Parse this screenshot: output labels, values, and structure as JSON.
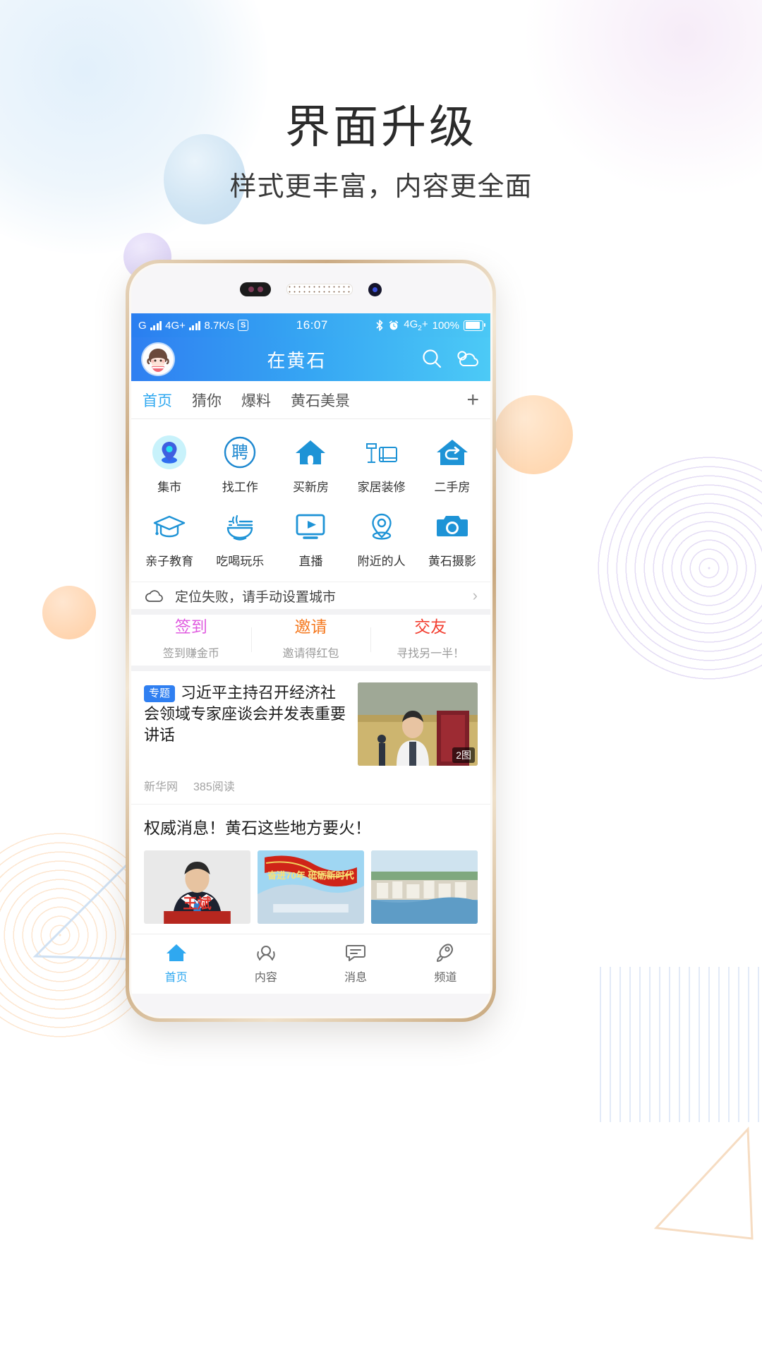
{
  "promo": {
    "title": "界面升级",
    "subtitle": "样式更丰富，内容更全面"
  },
  "phone": {
    "statusbar": {
      "carrier": "G",
      "network1": "4G+",
      "speed": "8.7K/s",
      "sync_badge": "S",
      "time": "16:07",
      "bluetooth_icon": "bluetooth-icon",
      "alarm_icon": "alarm-clock-icon",
      "network2": "4G",
      "network2_sub": "2",
      "network2_plus": "+",
      "battery": "100%"
    },
    "appbar": {
      "avatar": "user-avatar",
      "title": "在黄石",
      "search_icon": "search-icon",
      "weather_icon": "weather-cloud-icon"
    },
    "tabs": {
      "items": [
        {
          "label": "首页",
          "active": true
        },
        {
          "label": "猜你",
          "active": false
        },
        {
          "label": "爆料",
          "active": false
        },
        {
          "label": "黄石美景",
          "active": false
        }
      ],
      "add_label": "+"
    },
    "grid": [
      {
        "label": "集市",
        "icon": "location-pin-icon"
      },
      {
        "label": "找工作",
        "icon": "hire-circle-icon"
      },
      {
        "label": "买新房",
        "icon": "house-icon"
      },
      {
        "label": "家居装修",
        "icon": "furniture-icon"
      },
      {
        "label": "二手房",
        "icon": "secondhand-house-icon"
      },
      {
        "label": "亲子教育",
        "icon": "graduation-cap-icon"
      },
      {
        "label": "吃喝玩乐",
        "icon": "noodle-bowl-icon"
      },
      {
        "label": "直播",
        "icon": "live-play-icon"
      },
      {
        "label": "附近的人",
        "icon": "nearby-pin-icon"
      },
      {
        "label": "黄石摄影",
        "icon": "camera-icon"
      }
    ],
    "locate": {
      "icon": "cloud-icon",
      "text": "定位失败，请手动设置城市",
      "chevron": "›"
    },
    "actions": [
      {
        "title": "签到",
        "subtitle": "签到赚金币",
        "color": "#e05ce0"
      },
      {
        "title": "邀请",
        "subtitle": "邀请得红包",
        "color": "#f5791f"
      },
      {
        "title": "交友",
        "subtitle": "寻找另一半！",
        "color": "#f23c2e"
      }
    ],
    "news_main": {
      "tag": "专题",
      "title": "习近平主持召开经济社会领域专家座谈会并发表重要讲话",
      "source": "新华网",
      "reads": "385阅读",
      "thumb_tag": "2图"
    },
    "news_second": {
      "title": "权威消息！黄石这些地方要火！",
      "image_captions": [
        "王斌",
        "奋进70年 砥砺新时代",
        ""
      ]
    },
    "bottom_nav": [
      {
        "label": "首页",
        "icon": "home-icon",
        "active": true
      },
      {
        "label": "内容",
        "icon": "content-icon",
        "active": false
      },
      {
        "label": "消息",
        "icon": "message-icon",
        "active": false
      },
      {
        "label": "频道",
        "icon": "channel-icon",
        "active": false
      }
    ]
  },
  "theme": {
    "accent": "#2fa8f0",
    "header_start": "#2f7ff1",
    "header_end": "#4ccaf6",
    "icon_blue": "#2193d4"
  }
}
